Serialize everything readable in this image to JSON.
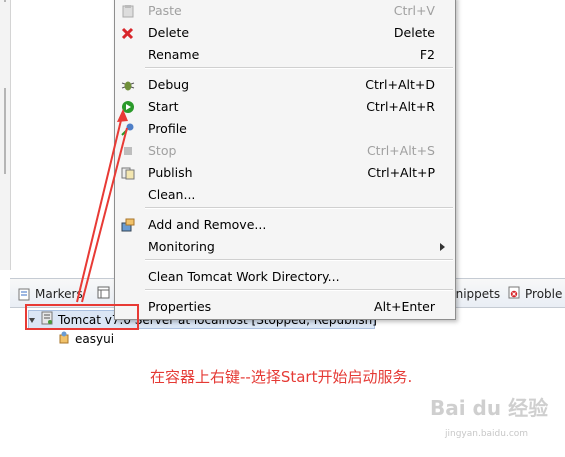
{
  "context_menu": {
    "items": [
      {
        "label": "Paste",
        "shortcut": "Ctrl+V",
        "icon": "paste-icon",
        "disabled": true
      },
      {
        "label": "Delete",
        "shortcut": "Delete",
        "icon": "delete-icon",
        "disabled": false
      },
      {
        "label": "Rename",
        "shortcut": "F2",
        "icon": "",
        "disabled": false
      },
      {
        "label": "Debug",
        "shortcut": "Ctrl+Alt+D",
        "icon": "debug-icon",
        "disabled": false
      },
      {
        "label": "Start",
        "shortcut": "Ctrl+Alt+R",
        "icon": "start-icon",
        "disabled": false
      },
      {
        "label": "Profile",
        "shortcut": "",
        "icon": "profile-icon",
        "disabled": false
      },
      {
        "label": "Stop",
        "shortcut": "Ctrl+Alt+S",
        "icon": "stop-icon",
        "disabled": true
      },
      {
        "label": "Publish",
        "shortcut": "Ctrl+Alt+P",
        "icon": "publish-icon",
        "disabled": false
      },
      {
        "label": "Clean...",
        "shortcut": "",
        "icon": "",
        "disabled": false
      },
      {
        "label": "Add and Remove...",
        "shortcut": "",
        "icon": "add-remove-icon",
        "disabled": false
      },
      {
        "label": "Monitoring",
        "shortcut": "",
        "icon": "",
        "disabled": false,
        "submenu": true
      },
      {
        "label": "Clean Tomcat Work Directory...",
        "shortcut": "",
        "icon": "",
        "disabled": false
      },
      {
        "label": "Properties",
        "shortcut": "Alt+Enter",
        "icon": "",
        "disabled": false
      }
    ]
  },
  "tabs": {
    "markers": "Markers",
    "snippets": "Snippets",
    "problems": "Proble"
  },
  "tree": {
    "server": "Tomcat v7.0 Server at localhost  [Stopped, Republish]",
    "project": "easyui"
  },
  "annotation": "在容器上右键--选择Start开始启动服务.",
  "watermark": {
    "main": "Bai du 经验",
    "sub": "jingyan.baidu.com"
  },
  "colors": {
    "annotation": "#e53a35",
    "highlight": "#e83a35",
    "start_green": "#2a9a2a",
    "delete_red": "#d8262b"
  }
}
